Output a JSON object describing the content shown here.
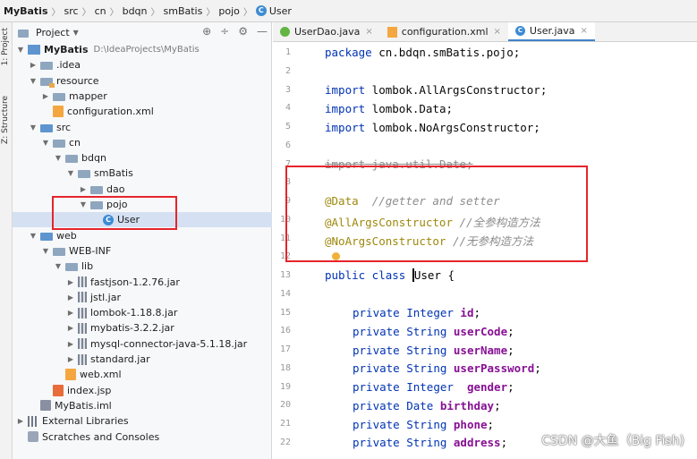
{
  "breadcrumb": {
    "items": [
      "MyBatis",
      "src",
      "cn",
      "bdqn",
      "smBatis",
      "pojo",
      "User"
    ],
    "separator": "〉"
  },
  "stripe": {
    "project_label": "1: Project",
    "structure_label": "Z: Structure"
  },
  "panel": {
    "title": "Project",
    "dropdown_glyph": "▼",
    "icons": [
      "⊕",
      "÷",
      "⚙",
      "—"
    ]
  },
  "tree": [
    {
      "label": "MyBatis",
      "path": "D:\\IdeaProjects\\MyBatis",
      "arrow": "▼",
      "icon": "project"
    },
    {
      "label": ".idea",
      "arrow": "▶",
      "icon": "folder"
    },
    {
      "label": "resource",
      "arrow": "▼",
      "icon": "folder-orange"
    },
    {
      "label": "mapper",
      "arrow": "▶",
      "icon": "folder"
    },
    {
      "label": "configuration.xml",
      "arrow": "",
      "icon": "xml"
    },
    {
      "label": "src",
      "arrow": "▼",
      "icon": "folder-blue"
    },
    {
      "label": "cn",
      "arrow": "▼",
      "icon": "folder"
    },
    {
      "label": "bdqn",
      "arrow": "▼",
      "icon": "folder"
    },
    {
      "label": "smBatis",
      "arrow": "▼",
      "icon": "folder"
    },
    {
      "label": "dao",
      "arrow": "▶",
      "icon": "folder"
    },
    {
      "label": "pojo",
      "arrow": "▼",
      "icon": "folder"
    },
    {
      "label": "User",
      "arrow": "",
      "icon": "class"
    },
    {
      "label": "web",
      "arrow": "▼",
      "icon": "folder-blue"
    },
    {
      "label": "WEB-INF",
      "arrow": "▼",
      "icon": "folder"
    },
    {
      "label": "lib",
      "arrow": "▼",
      "icon": "folder"
    },
    {
      "label": "fastjson-1.2.76.jar",
      "arrow": "▶",
      "icon": "jar"
    },
    {
      "label": "jstl.jar",
      "arrow": "▶",
      "icon": "jar"
    },
    {
      "label": "lombok-1.18.8.jar",
      "arrow": "▶",
      "icon": "jar"
    },
    {
      "label": "mybatis-3.2.2.jar",
      "arrow": "▶",
      "icon": "jar"
    },
    {
      "label": "mysql-connector-java-5.1.18.jar",
      "arrow": "▶",
      "icon": "jar"
    },
    {
      "label": "standard.jar",
      "arrow": "▶",
      "icon": "jar"
    },
    {
      "label": "web.xml",
      "arrow": "",
      "icon": "xml"
    },
    {
      "label": "index.jsp",
      "arrow": "",
      "icon": "jsp"
    },
    {
      "label": "MyBatis.iml",
      "arrow": "",
      "icon": "iml"
    },
    {
      "label": "External Libraries",
      "arrow": "▶",
      "icon": "lib"
    },
    {
      "label": "Scratches and Consoles",
      "arrow": "",
      "icon": "scratch"
    }
  ],
  "tabs": [
    {
      "label": "UserDao.java",
      "icon": "interface",
      "active": false
    },
    {
      "label": "configuration.xml",
      "icon": "xml",
      "active": false
    },
    {
      "label": "User.java",
      "icon": "class",
      "active": true
    }
  ],
  "tab_close": "×",
  "code": {
    "package_kw": "package",
    "package_name": " cn.bdqn.smBatis.pojo;",
    "import_kw": "import",
    "import1": " lombok.AllArgsConstructor;",
    "import2": " lombok.Data;",
    "import3": " lombok.NoArgsConstructor;",
    "import4": " java.util.Date;",
    "ann1": "@Data",
    "ann1_comment": "  //getter and setter",
    "ann2": "@AllArgsConstructor",
    "ann2_comment": " //全参构造方法",
    "ann3": "@NoArgsConstructor",
    "ann3_comment": " //无参构造方法",
    "class_decl_kw": "public class ",
    "class_name": "User",
    "class_brace": " {",
    "private_kw": "private",
    "fields": [
      {
        "type": " Integer ",
        "name": "id",
        "end": ";"
      },
      {
        "type": " String ",
        "name": "userCode",
        "end": ";"
      },
      {
        "type": " String ",
        "name": "userName",
        "end": ";"
      },
      {
        "type": " String ",
        "name": "userPassword",
        "end": ";"
      },
      {
        "type": " Integer  ",
        "name": "gender",
        "end": ";"
      },
      {
        "type": " Date ",
        "name": "birthday",
        "end": ";"
      },
      {
        "type": " String ",
        "name": "phone",
        "end": ";"
      },
      {
        "type": " String ",
        "name": "address",
        "end": ";"
      }
    ],
    "line_numbers": [
      "1",
      "2",
      "3",
      "4",
      "5",
      "6",
      "7",
      "8",
      "9",
      "10",
      "11",
      "12",
      "13",
      "14",
      "15",
      "16",
      "17",
      "18",
      "19",
      "20",
      "21",
      "22"
    ]
  },
  "watermark": "CSDN @大鱼（Big Fish)",
  "colors": {
    "annotation_box": "#e6242b",
    "selection": "#d5e1f2",
    "keyword": "#0033b3",
    "field": "#871094"
  }
}
